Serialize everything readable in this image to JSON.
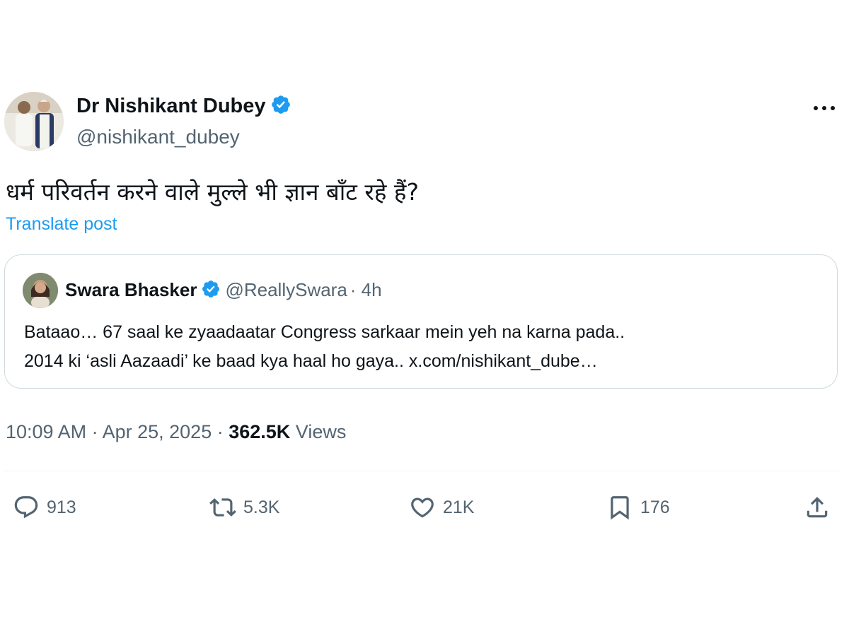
{
  "tweet": {
    "author": {
      "name": "Dr Nishikant Dubey",
      "handle": "@nishikant_dubey",
      "verified": true
    },
    "text": "धर्म परिवर्तन करने वाले मुल्ले भी ज्ञान बॉंट रहे हैं?",
    "translate_label": "Translate post",
    "quote": {
      "name": "Swara Bhasker",
      "handle": "@ReallySwara",
      "time": "· 4h",
      "line1": "Bataao… 67 saal ke zyaadaatar Congress sarkaar mein yeh na karna pada..",
      "line2": "2014 ki ‘asli Aazaadi’ ke baad kya haal ho gaya.. x.com/nishikant_dube…"
    },
    "meta": {
      "time": "10:09 AM",
      "sep1": " · ",
      "date": "Apr 25, 2025",
      "sep2": " · ",
      "views_count": "362.5K",
      "views_label": " Views"
    },
    "actions": {
      "replies": "913",
      "reposts": "5.3K",
      "likes": "21K",
      "bookmarks": "176"
    }
  },
  "colors": {
    "accent": "#1d9bf0",
    "muted": "#536471",
    "border": "#cfd9de",
    "text": "#0f1419"
  },
  "icons": [
    "verified-badge-icon",
    "more-icon",
    "reply-icon",
    "repost-icon",
    "like-icon",
    "bookmark-icon",
    "share-icon"
  ]
}
